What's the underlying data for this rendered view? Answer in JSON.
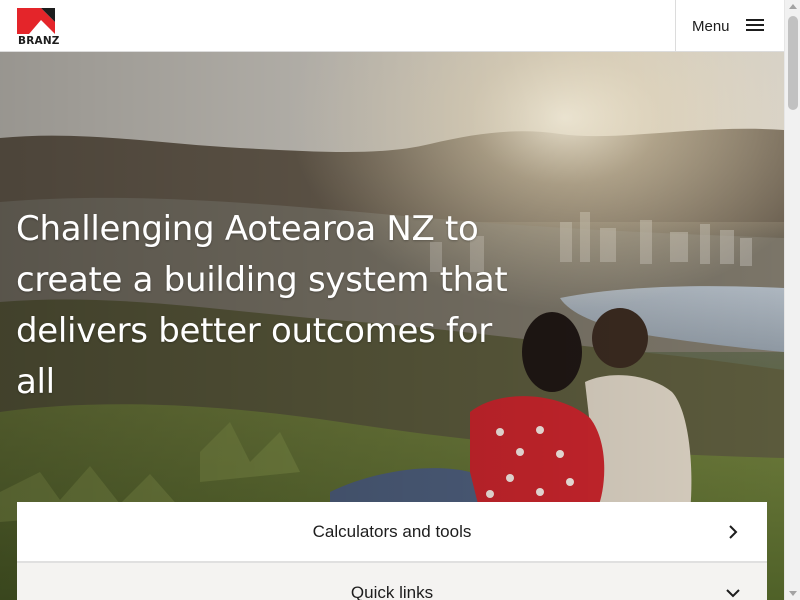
{
  "brand": {
    "logo_text": "BRANZ",
    "logo_color_red": "#e4252a",
    "logo_color_dark": "#1d1d1d"
  },
  "header": {
    "menu_label": "Menu"
  },
  "hero": {
    "headline": "Challenging Aotearoa NZ to create a building system that delivers better outcomes for all",
    "image_subject": "couple-on-hillside-overlooking-city"
  },
  "panels": {
    "calculators_label": "Calculators and tools",
    "quick_links_label": "Quick links"
  },
  "icons": {
    "menu": "hamburger-icon",
    "calculators": "chevron-right-icon",
    "quick_links": "chevron-down-icon"
  }
}
